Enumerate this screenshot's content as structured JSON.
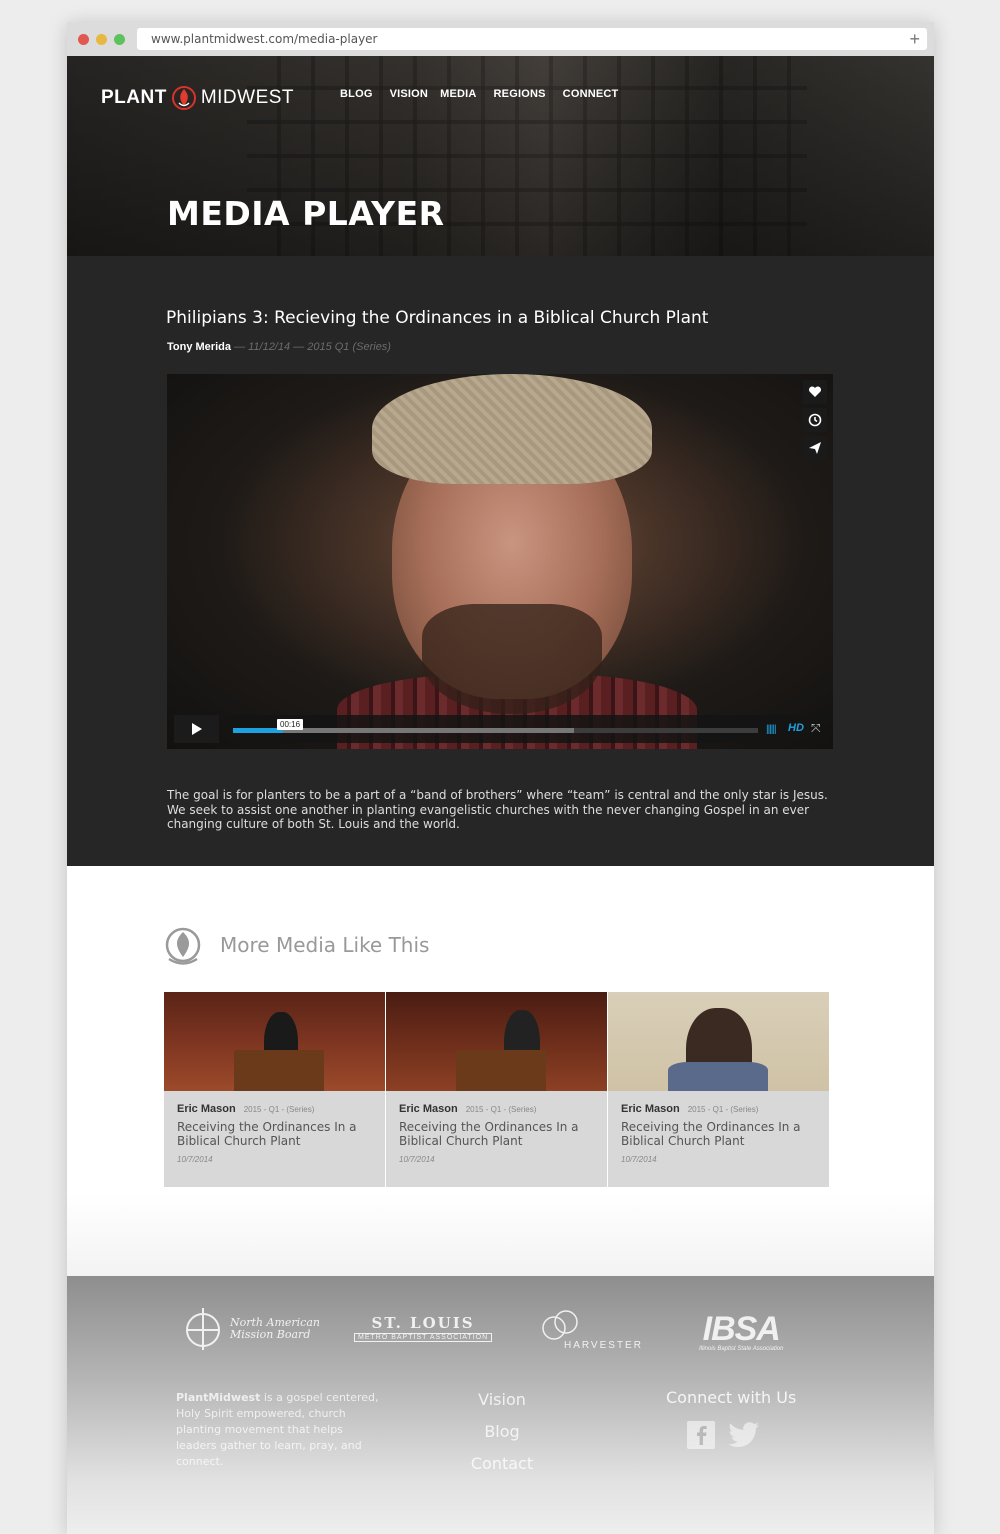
{
  "browser": {
    "url": "www.plantmidwest.com/media-player",
    "new_tab_symbol": "+"
  },
  "header": {
    "logo_left": "PLANT",
    "logo_right": "MIDWEST",
    "nav": [
      "BLOG",
      "VISION",
      "MEDIA",
      "REGIONS",
      "CONNECT"
    ],
    "page_title": "MEDIA PLAYER"
  },
  "media": {
    "title": "Philipians 3: Recieving the Ordinances in a Biblical Church Plant",
    "author": "Tony Merida",
    "meta": " — 11/12/14 — 2015 Q1 (Series)",
    "player": {
      "time_tooltip": "00:16",
      "hd_label": "HD",
      "progress": 0.095,
      "buffered": 0.65
    },
    "description": "The goal is for planters to be a part of a “band of brothers” where “team” is central and the only star is Jesus. We seek to assist one another in planting evangelistic churches with the never changing Gospel in an ever changing culture of both St. Louis and the world."
  },
  "more": {
    "heading": "More Media Like This",
    "cards": [
      {
        "author": "Eric Mason",
        "series": "2015 - Q1 - (Series)",
        "title": "Receiving the Ordinances In a Biblical Church Plant",
        "date": "10/7/2014"
      },
      {
        "author": "Eric Mason",
        "series": "2015 - Q1 - (Series)",
        "title": "Receiving the Ordinances In a Biblical Church Plant",
        "date": "10/7/2014"
      },
      {
        "author": "Eric Mason",
        "series": "2015 - Q1 - (Series)",
        "title": "Receiving the Ordinances In a Biblical Church Plant",
        "date": "10/7/2014"
      }
    ]
  },
  "footer": {
    "partners": {
      "namb_line1": "North American",
      "namb_line2": "Mission Board",
      "stl_big": "ST. LOUIS",
      "stl_small": "METRO BAPTIST ASSOCIATION",
      "harvester": "HARVESTER",
      "ibsa_big": "IBSA",
      "ibsa_small": "Illinois Baptist State Association"
    },
    "about_brand": "PlantMidwest",
    "about_text": " is a gospel centered, Holy Spirit empowered, church planting movement that helps leaders gather to learn, pray, and connect.",
    "links": [
      "Vision",
      "Blog",
      "Contact"
    ],
    "connect_heading": "Connect with Us"
  }
}
